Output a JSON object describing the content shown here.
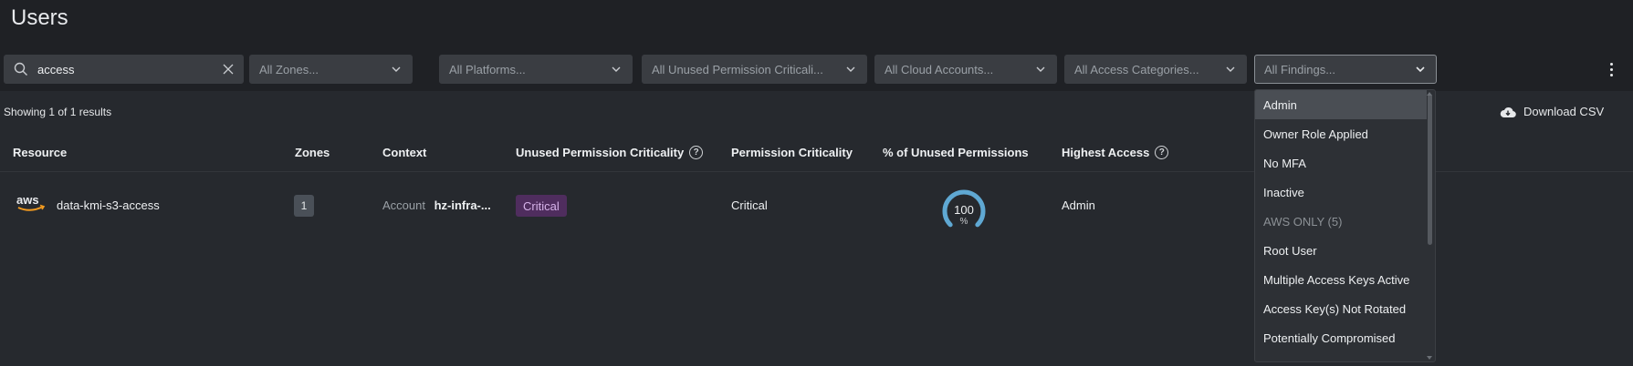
{
  "page": {
    "title": "Users"
  },
  "filters": {
    "search_value": "access",
    "zones": "All Zones...",
    "platforms": "All Platforms...",
    "unused_criticality": "All Unused Permission Criticali...",
    "cloud_accounts": "All Cloud Accounts...",
    "access_categories": "All Access Categories...",
    "findings": "All Findings..."
  },
  "results": {
    "showing": "Showing 1 of 1 results",
    "download": "Download CSV"
  },
  "table": {
    "headers": {
      "resource": "Resource",
      "zones": "Zones",
      "context": "Context",
      "unused_criticality": "Unused Permission Criticality",
      "permission_criticality": "Permission Criticality",
      "pct_unused": "% of Unused Permissions",
      "highest_access": "Highest Access"
    },
    "rows": [
      {
        "provider": "aws",
        "resource": "data-kmi-s3-access",
        "zones": "1",
        "context_label": "Account",
        "context_value": "hz-infra-...",
        "unused_criticality": "Critical",
        "permission_criticality": "Critical",
        "pct_unused": "100",
        "pct_unit": "%",
        "pct_value": 100,
        "highest_access": "Admin"
      }
    ]
  },
  "findings_dropdown": {
    "options": [
      {
        "label": "Admin",
        "highlighted": true
      },
      {
        "label": "Owner Role Applied"
      },
      {
        "label": "No MFA"
      },
      {
        "label": "Inactive"
      },
      {
        "label": "AWS ONLY (5)",
        "group": true
      },
      {
        "label": "Root User"
      },
      {
        "label": "Multiple Access Keys Active"
      },
      {
        "label": "Access Key(s) Not Rotated"
      },
      {
        "label": "Potentially Compromised"
      }
    ]
  },
  "colors": {
    "background": "#26292e",
    "header_background": "#1f2125",
    "gauge": "#5fa8d3",
    "critical_badge_bg": "#4f2d5e",
    "critical_badge_text": "#d7b3ea",
    "aws_orange": "#f29a1f"
  }
}
